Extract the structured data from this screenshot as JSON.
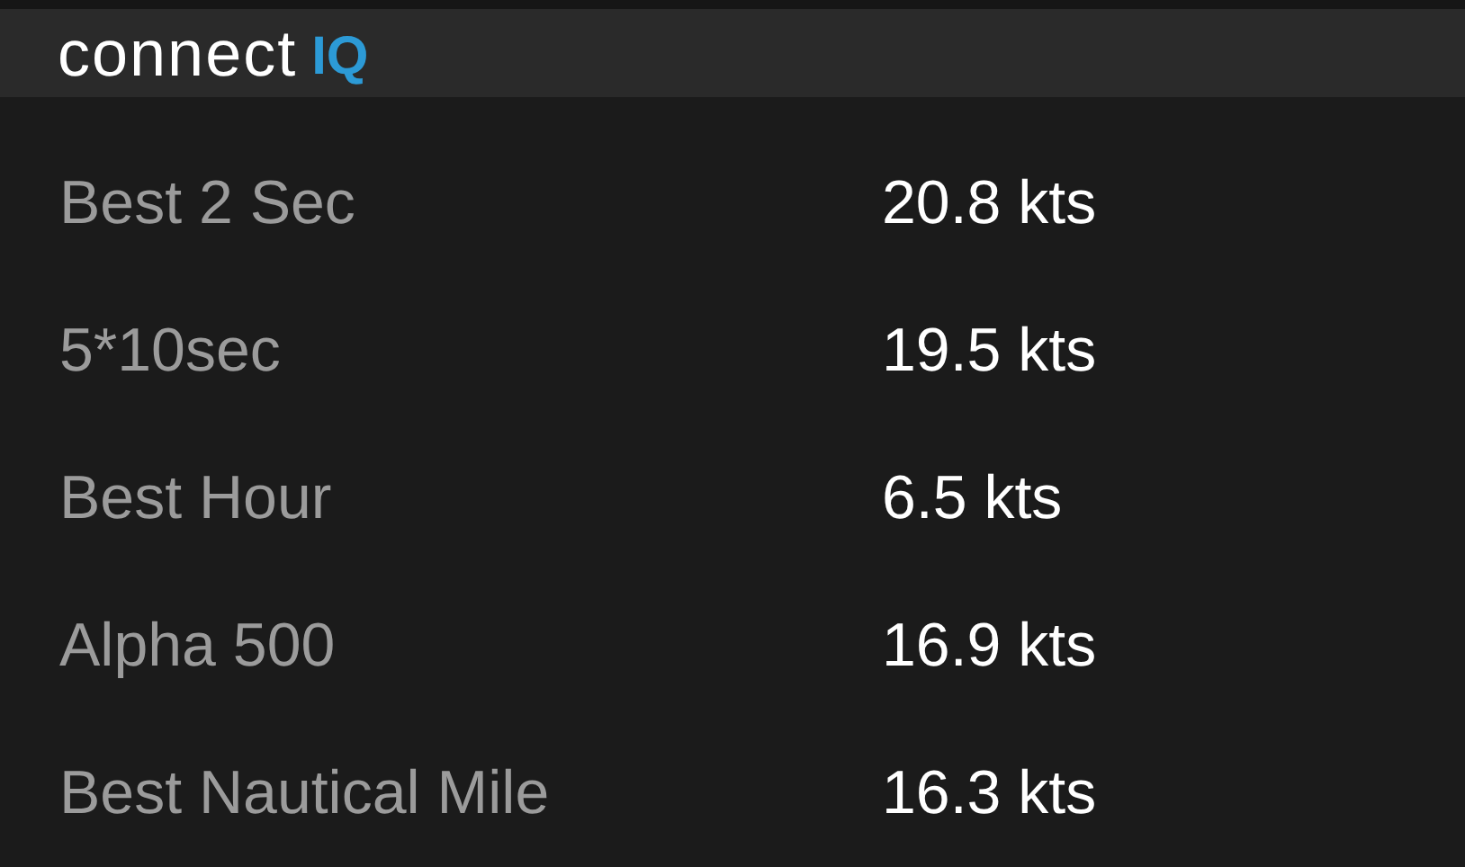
{
  "header": {
    "logo_word": "connect",
    "logo_mark": "IQ"
  },
  "rows": [
    {
      "label": "Best 2 Sec",
      "value": "20.8 kts"
    },
    {
      "label": "5*10sec",
      "value": "19.5 kts"
    },
    {
      "label": "Best Hour",
      "value": "6.5 kts"
    },
    {
      "label": "Alpha 500",
      "value": "16.9 kts"
    },
    {
      "label": "Best Nautical Mile",
      "value": "16.3 kts"
    }
  ]
}
